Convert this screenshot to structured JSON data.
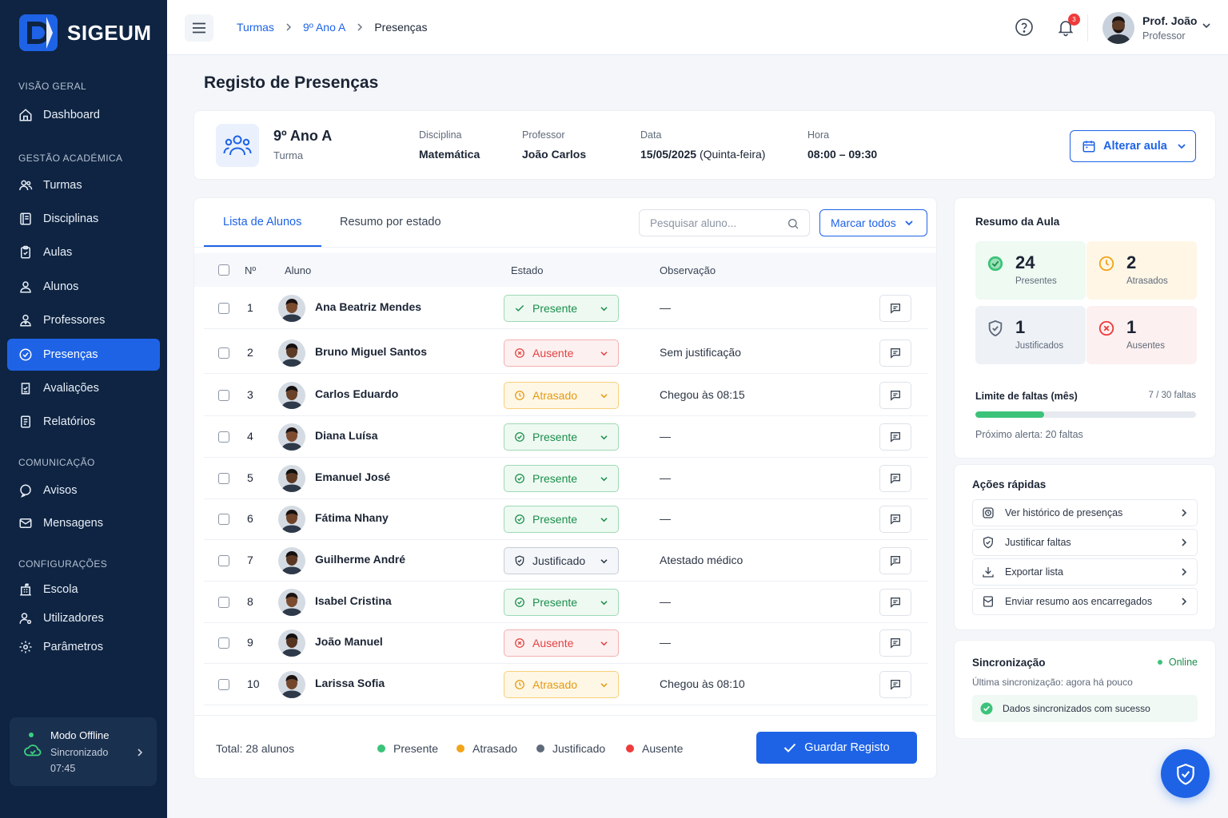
{
  "app": {
    "name": "SIGEUM"
  },
  "sidebar": {
    "sections": [
      {
        "title": "VISÃO GERAL"
      },
      {
        "title": "GESTÃO ACADÉMICA"
      },
      {
        "title": "COMUNICAÇÃO"
      },
      {
        "title": "CONFIGURAÇÕES"
      }
    ],
    "items": [
      {
        "label": "Dashboard",
        "icon": "home-icon"
      },
      {
        "label": "Turmas",
        "icon": "users-icon"
      },
      {
        "label": "Disciplinas",
        "icon": "book-icon"
      },
      {
        "label": "Aulas",
        "icon": "clipboard-icon"
      },
      {
        "label": "Alunos",
        "icon": "user-icon"
      },
      {
        "label": "Professores",
        "icon": "teacher-icon"
      },
      {
        "label": "Presenças",
        "icon": "check-circle-icon",
        "active": true
      },
      {
        "label": "Avaliações",
        "icon": "check-clipboard-icon"
      },
      {
        "label": "Relatórios",
        "icon": "document-icon"
      },
      {
        "label": "Avisos",
        "icon": "megaphone-icon"
      },
      {
        "label": "Mensagens",
        "icon": "mail-icon"
      },
      {
        "label": "Escola",
        "icon": "building-icon"
      },
      {
        "label": "Utilizadores",
        "icon": "users-gear-icon"
      },
      {
        "label": "Parâmetros",
        "icon": "gear-icon"
      }
    ],
    "offline": {
      "title": "Modo Offline",
      "status": "Sincronizado",
      "time": "07:45"
    }
  },
  "topbar": {
    "breadcrumb": [
      "Turmas",
      "9º Ano A",
      "Presenças"
    ],
    "notifications": "3",
    "user": {
      "name": "Prof. João",
      "role": "Professor"
    }
  },
  "page": {
    "title": "Registo de Presenças"
  },
  "class": {
    "name": "9º Ano A",
    "sub": "Turma",
    "discipline_label": "Disciplina",
    "discipline": "Matemática",
    "teacher_label": "Professor",
    "teacher": "João Carlos",
    "date_label": "Data",
    "date": "15/05/2025",
    "weekday": "(Quinta-feira)",
    "time_label": "Hora",
    "time": "08:00 – 09:30",
    "change_button": "Alterar aula"
  },
  "table": {
    "tabs": [
      "Lista de Alunos",
      "Resumo por estado"
    ],
    "search_placeholder": "Pesquisar aluno...",
    "mark_all": "Marcar todos",
    "headers": {
      "num": "Nº",
      "student": "Aluno",
      "status": "Estado",
      "note": "Observação"
    },
    "rows": [
      {
        "num": "1",
        "name": "Ana Beatriz Mendes",
        "status": "Presente",
        "type": "presente",
        "note": "—",
        "skin": "#7a4a2e",
        "hair": "#1a1110"
      },
      {
        "num": "2",
        "name": "Bruno Miguel Santos",
        "status": "Ausente",
        "type": "ausente",
        "note": "Sem justificação",
        "skin": "#5c3a26",
        "hair": "#151010"
      },
      {
        "num": "3",
        "name": "Carlos Eduardo",
        "status": "Atrasado",
        "type": "atrasado",
        "note": "Chegou às 08:15",
        "skin": "#6a4129",
        "hair": "#141010"
      },
      {
        "num": "4",
        "name": "Diana Luísa",
        "status": "Presente",
        "type": "presente",
        "note": "—",
        "skin": "#7e4d31",
        "hair": "#1c1412"
      },
      {
        "num": "5",
        "name": "Emanuel José",
        "status": "Presente",
        "type": "presente",
        "note": "—",
        "skin": "#5e3a25",
        "hair": "#131010"
      },
      {
        "num": "6",
        "name": "Fátima Nhany",
        "status": "Presente",
        "type": "presente",
        "note": "—",
        "skin": "#6f4429",
        "hair": "#181211"
      },
      {
        "num": "7",
        "name": "Guilherme André",
        "status": "Justificado",
        "type": "justificado",
        "note": "Atestado médico",
        "skin": "#5a3723",
        "hair": "#141010"
      },
      {
        "num": "8",
        "name": "Isabel Cristina",
        "status": "Presente",
        "type": "presente",
        "note": "—",
        "skin": "#7b4b2f",
        "hair": "#1b1311"
      },
      {
        "num": "9",
        "name": "João Manuel",
        "status": "Ausente",
        "type": "ausente",
        "note": "—",
        "skin": "#553422",
        "hair": "#121010"
      },
      {
        "num": "10",
        "name": "Larissa Sofia",
        "status": "Atrasado",
        "type": "atrasado",
        "note": "Chegou às 08:10",
        "skin": "#74472c",
        "hair": "#1a1210"
      }
    ],
    "total": "Total: 28 alunos",
    "legend": [
      {
        "label": "Presente",
        "color": "#3cc37a"
      },
      {
        "label": "Atrasado",
        "color": "#f2a51a"
      },
      {
        "label": "Justificado",
        "color": "#5f6a7a"
      },
      {
        "label": "Ausente",
        "color": "#ef3b3b"
      }
    ],
    "save_button": "Guardar Registo"
  },
  "summary": {
    "title": "Resumo da Aula",
    "stats": [
      {
        "value": "24",
        "label": "Presentes"
      },
      {
        "value": "2",
        "label": "Atrasados"
      },
      {
        "value": "1",
        "label": "Justificados"
      },
      {
        "value": "1",
        "label": "Ausentes"
      }
    ],
    "limit_label": "Limite de faltas (mês)",
    "limit_value": "7 / 30 faltas",
    "limit_fraction": 0.31,
    "next_alert": "Próximo alerta: 20 faltas"
  },
  "actions": {
    "title": "Ações rápidas",
    "items": [
      "Ver histórico de presenças",
      "Justificar faltas",
      "Exportar lista",
      "Enviar resumo aos encarregados"
    ]
  },
  "sync": {
    "title": "Sincronização",
    "status": "Online",
    "last": "Última sincronização: agora há pouco",
    "message": "Dados sincronizados com sucesso"
  },
  "colors": {
    "primary": "#1e63e6",
    "sidebar": "#0e2442",
    "present": "#3cc37a",
    "late": "#f2a51a",
    "absent": "#ef3b3b"
  }
}
